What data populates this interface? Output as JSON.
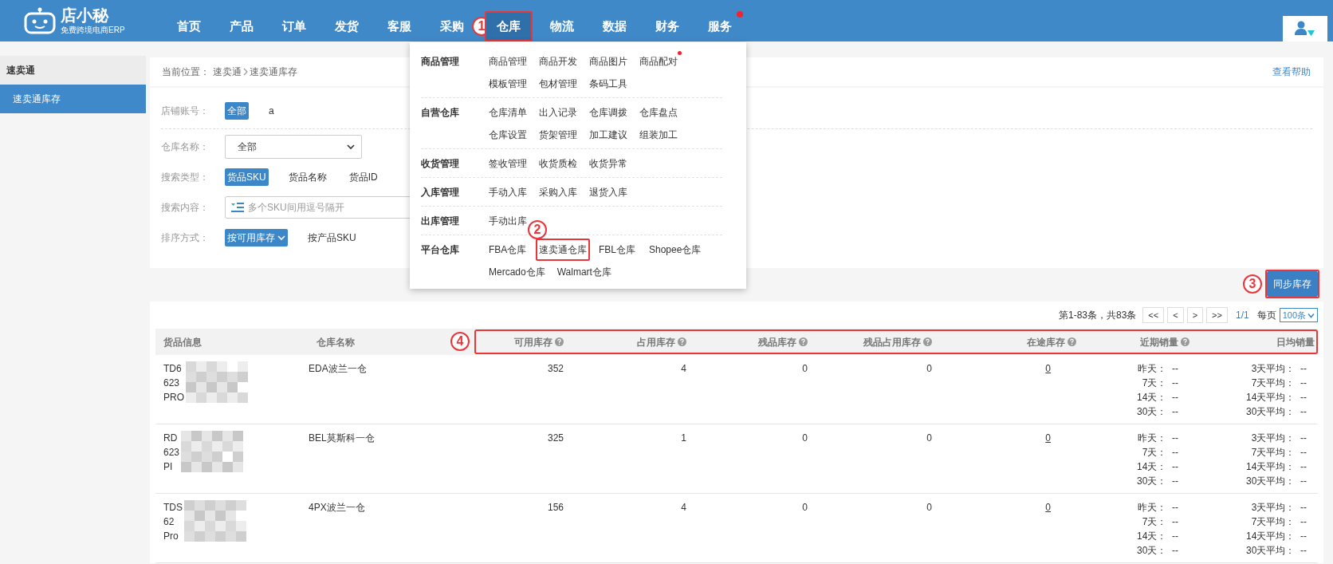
{
  "logo": {
    "name": "店小秘",
    "tagline": "免费跨境电商ERP"
  },
  "nav": [
    {
      "label": "首页",
      "selected": false,
      "highlighted": false,
      "dot": false
    },
    {
      "label": "产品",
      "selected": false,
      "highlighted": false,
      "dot": false
    },
    {
      "label": "订单",
      "selected": false,
      "highlighted": false,
      "dot": false
    },
    {
      "label": "发货",
      "selected": false,
      "highlighted": false,
      "dot": false
    },
    {
      "label": "客服",
      "selected": false,
      "highlighted": false,
      "dot": false
    },
    {
      "label": "采购",
      "selected": false,
      "highlighted": false,
      "dot": false
    },
    {
      "label": "仓库",
      "selected": true,
      "highlighted": true,
      "dot": false,
      "callout": "1"
    },
    {
      "label": "物流",
      "selected": false,
      "highlighted": false,
      "dot": false
    },
    {
      "label": "数据",
      "selected": false,
      "highlighted": false,
      "dot": false
    },
    {
      "label": "财务",
      "selected": false,
      "highlighted": false,
      "dot": false
    },
    {
      "label": "服务",
      "selected": false,
      "highlighted": false,
      "dot": true
    }
  ],
  "sidebar": {
    "title": "速卖通",
    "items": [
      {
        "label": "速卖通库存",
        "selected": true
      }
    ]
  },
  "breadcrumb": {
    "label": "当前位置：",
    "path": [
      "速卖通",
      "速卖通库存"
    ],
    "help_link": "查看帮助"
  },
  "filters": [
    {
      "kind": "chips",
      "label": "店铺账号：",
      "options": [
        {
          "label": "全部",
          "selected": true
        },
        {
          "label": "a",
          "selected": false
        }
      ]
    },
    {
      "kind": "select",
      "label": "仓库名称：",
      "value": "全部"
    },
    {
      "kind": "chips",
      "label": "搜索类型：",
      "options": [
        {
          "label": "货品SKU",
          "selected": true
        },
        {
          "label": "货品名称",
          "selected": false
        },
        {
          "label": "货品ID",
          "selected": false
        }
      ]
    },
    {
      "kind": "text",
      "label": "搜索内容：",
      "placeholder": "多个SKU间用逗号隔开"
    },
    {
      "kind": "sort",
      "label": "排序方式：",
      "options": [
        {
          "label": "按可用库存",
          "selected": true
        },
        {
          "label": "按产品SKU",
          "selected": false
        }
      ]
    }
  ],
  "menu": {
    "groups": [
      {
        "title": "商品管理",
        "items": [
          {
            "label": "商品管理",
            "dot": false,
            "highlighted": false
          },
          {
            "label": "商品开发",
            "dot": false,
            "highlighted": false
          },
          {
            "label": "商品图片",
            "dot": false,
            "highlighted": false
          },
          {
            "label": "商品配对",
            "dot": true,
            "highlighted": false
          },
          {
            "label": "模板管理",
            "dot": false,
            "highlighted": false
          },
          {
            "label": "包材管理",
            "dot": false,
            "highlighted": false
          },
          {
            "label": "条码工具",
            "dot": false,
            "highlighted": false
          }
        ]
      },
      {
        "title": "自营仓库",
        "items": [
          {
            "label": "仓库清单",
            "dot": false,
            "highlighted": false
          },
          {
            "label": "出入记录",
            "dot": false,
            "highlighted": false
          },
          {
            "label": "仓库调拨",
            "dot": false,
            "highlighted": false
          },
          {
            "label": "仓库盘点",
            "dot": false,
            "highlighted": false
          },
          {
            "label": "仓库设置",
            "dot": false,
            "highlighted": false
          },
          {
            "label": "货架管理",
            "dot": false,
            "highlighted": false
          },
          {
            "label": "加工建议",
            "dot": false,
            "highlighted": false
          },
          {
            "label": "组装加工",
            "dot": false,
            "highlighted": false
          }
        ]
      },
      {
        "title": "收货管理",
        "items": [
          {
            "label": "签收管理",
            "dot": false,
            "highlighted": false
          },
          {
            "label": "收货质检",
            "dot": false,
            "highlighted": false
          },
          {
            "label": "收货异常",
            "dot": false,
            "highlighted": false
          }
        ]
      },
      {
        "title": "入库管理",
        "items": [
          {
            "label": "手动入库",
            "dot": false,
            "highlighted": false
          },
          {
            "label": "采购入库",
            "dot": false,
            "highlighted": false
          },
          {
            "label": "退货入库",
            "dot": false,
            "highlighted": false
          }
        ]
      },
      {
        "title": "出库管理",
        "items": [
          {
            "label": "手动出库",
            "dot": false,
            "highlighted": false
          }
        ]
      },
      {
        "title": "平台仓库",
        "items": [
          {
            "label": "FBA仓库",
            "dot": false,
            "highlighted": false
          },
          {
            "label": "速卖通仓库",
            "dot": false,
            "highlighted": true,
            "callout": "2"
          },
          {
            "label": "FBL仓库",
            "dot": false,
            "highlighted": false
          },
          {
            "label": "Shopee仓库",
            "dot": false,
            "highlighted": false
          },
          {
            "label": "Mercado仓库",
            "dot": false,
            "highlighted": false
          },
          {
            "label": "Walmart仓库",
            "dot": false,
            "highlighted": false
          }
        ]
      }
    ]
  },
  "sync_button": {
    "label": "同步库存",
    "highlighted": true,
    "callout": "3"
  },
  "pagination": {
    "summary": "第1-83条，共83条",
    "buttons": [
      "<<",
      "<",
      ">",
      ">>"
    ],
    "page": "1/1",
    "per_page_label": "每页",
    "per_page": "100条"
  },
  "table": {
    "columns": [
      {
        "label": "货品信息",
        "help": false
      },
      {
        "label": "仓库名称",
        "help": false
      }
    ],
    "annotated_columns": {
      "callout": "4",
      "columns": [
        {
          "label": "可用库存",
          "help": true
        },
        {
          "label": "占用库存",
          "help": true
        },
        {
          "label": "残品库存",
          "help": true
        },
        {
          "label": "残品占用库存",
          "help": true
        },
        {
          "label": "在途库存",
          "help": true
        },
        {
          "label": "近期销量",
          "help": true
        },
        {
          "label": "日均销量",
          "help": false
        }
      ]
    },
    "rows": [
      {
        "sku_lines": [
          "TD6",
          "623",
          "PRO"
        ],
        "sku_redacted": true,
        "warehouse": "EDA波兰一仓",
        "available": "352",
        "occupied": "4",
        "defective": "0",
        "defective_occupied": "0",
        "in_transit": "0",
        "recent_sales": [
          "昨天：  --",
          "7天：  --",
          "14天：  --",
          "30天：  --"
        ],
        "daily_avg": [
          "3天平均：  --",
          "7天平均：  --",
          "14天平均：  --",
          "30天平均：  --"
        ]
      },
      {
        "sku_lines": [
          "RD",
          "623",
          "PI"
        ],
        "sku_redacted": true,
        "warehouse": "BEL莫斯科一仓",
        "available": "325",
        "occupied": "1",
        "defective": "0",
        "defective_occupied": "0",
        "in_transit": "0",
        "recent_sales": [
          "昨天：  --",
          "7天：  --",
          "14天：  --",
          "30天：  --"
        ],
        "daily_avg": [
          "3天平均：  --",
          "7天平均：  --",
          "14天平均：  --",
          "30天平均：  --"
        ]
      },
      {
        "sku_lines": [
          "TDS",
          "62",
          "Pro"
        ],
        "sku_redacted": true,
        "warehouse": "4PX波兰一仓",
        "available": "156",
        "occupied": "4",
        "defective": "0",
        "defective_occupied": "0",
        "in_transit": "0",
        "recent_sales": [
          "昨天：  --",
          "7天：  --",
          "14天：  --",
          "30天：  --"
        ],
        "daily_avg": [
          "3天平均：  --",
          "7天平均：  --",
          "14天平均：  --",
          "30天平均：  --"
        ]
      }
    ]
  }
}
